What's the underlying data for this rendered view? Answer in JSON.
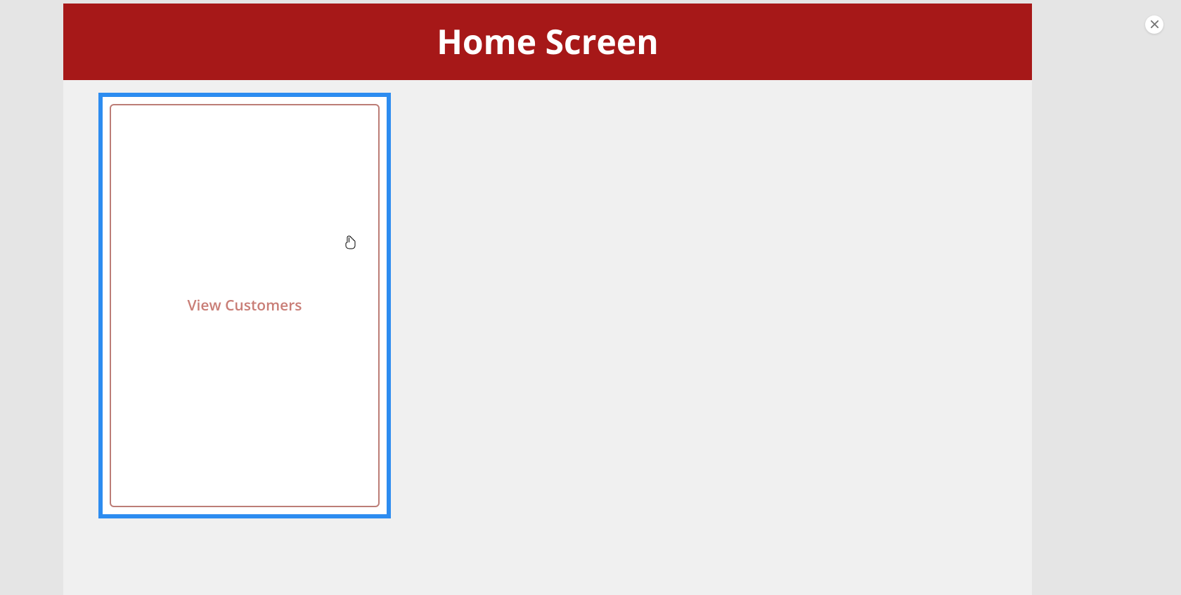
{
  "header": {
    "title": "Home Screen"
  },
  "cards": [
    {
      "label": "View Customers"
    }
  ],
  "colors": {
    "header_bg": "#a61818",
    "card_highlight_border": "#2d8cf0",
    "card_inner_border": "#bc7d77",
    "card_text": "#c97e77"
  }
}
